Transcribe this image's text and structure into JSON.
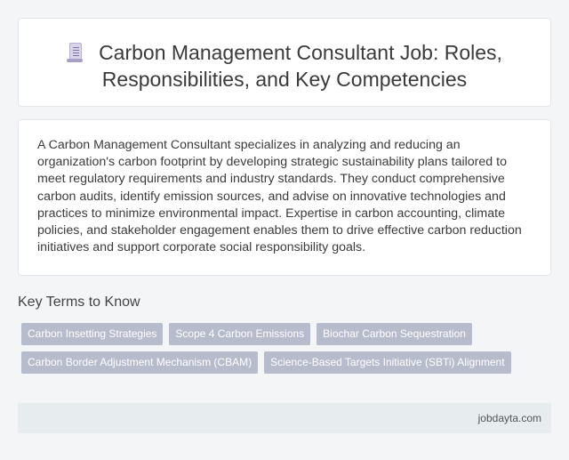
{
  "header": {
    "icon": "document-icon",
    "title": "Carbon Management Consultant Job: Roles, Responsibilities, and Key Competencies"
  },
  "description": "A Carbon Management Consultant specializes in analyzing and reducing an organization's carbon footprint by developing strategic sustainability plans tailored to meet regulatory requirements and industry standards. They conduct comprehensive carbon audits, identify emission sources, and advise on innovative technologies and practices to minimize environmental impact. Expertise in carbon accounting, climate policies, and stakeholder engagement enables them to drive effective carbon reduction initiatives and support corporate social responsibility goals.",
  "key_terms": {
    "heading": "Key Terms to Know",
    "tags": [
      "Carbon Insetting Strategies",
      "Scope 4 Carbon Emissions",
      "Biochar Carbon Sequestration",
      "Carbon Border Adjustment Mechanism (CBAM)",
      "Science-Based Targets Initiative (SBTi) Alignment"
    ]
  },
  "footer": {
    "site": "jobdayta.com"
  },
  "colors": {
    "background": "#f3f5f7",
    "card": "#ffffff",
    "tag": "#b7bccd",
    "footer": "#e7ecef"
  }
}
